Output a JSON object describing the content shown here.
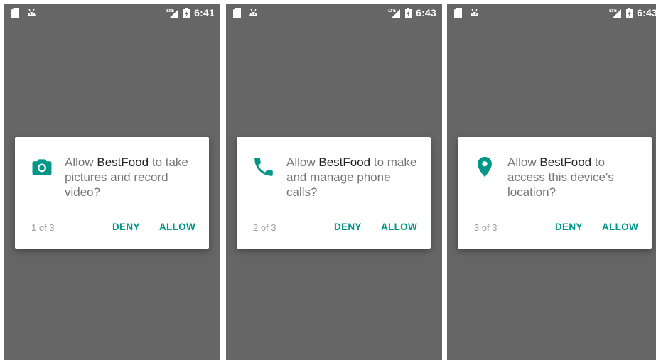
{
  "colors": {
    "accent": "#009688",
    "scrim": "#666666",
    "dialog": "#ffffff"
  },
  "screens": [
    {
      "status": {
        "time": "6:41",
        "network": "LTE"
      },
      "dialog": {
        "icon": "camera-icon",
        "prefix": "Allow ",
        "app": "BestFood",
        "suffix": " to take pictures and record video?",
        "counter": "1 of 3",
        "deny": "DENY",
        "allow": "ALLOW"
      }
    },
    {
      "status": {
        "time": "6:43",
        "network": "LTE"
      },
      "dialog": {
        "icon": "phone-icon",
        "prefix": "Allow ",
        "app": "BestFood",
        "suffix": " to make and manage phone calls?",
        "counter": "2 of 3",
        "deny": "DENY",
        "allow": "ALLOW"
      }
    },
    {
      "status": {
        "time": "6:43",
        "network": "LTE"
      },
      "dialog": {
        "icon": "location-pin-icon",
        "prefix": "Allow ",
        "app": "BestFood",
        "suffix": " to access this device's location?",
        "counter": "3 of 3",
        "deny": "DENY",
        "allow": "ALLOW"
      }
    }
  ]
}
